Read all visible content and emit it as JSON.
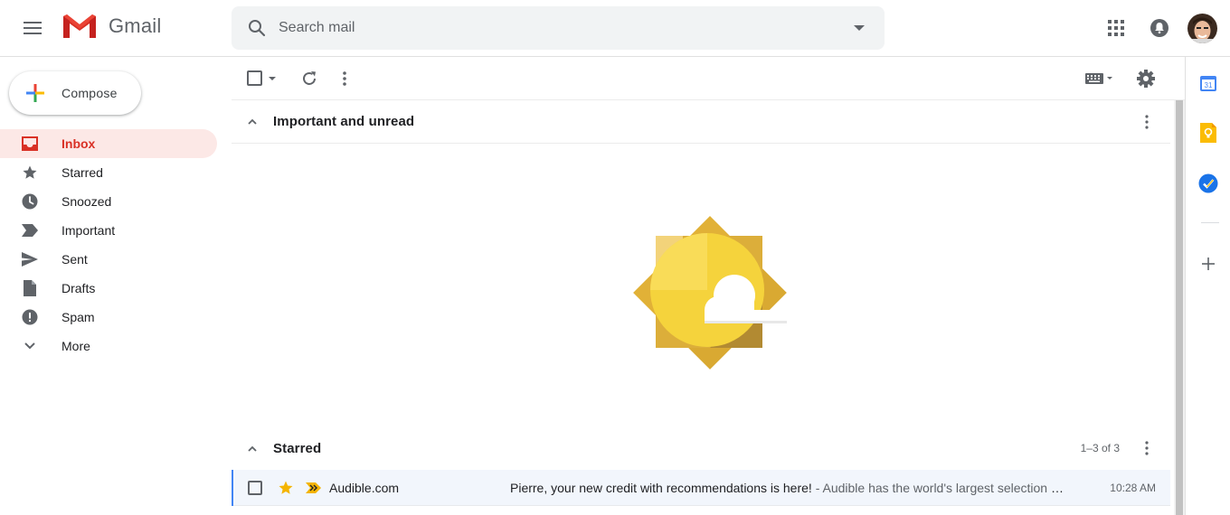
{
  "app": {
    "name": "Gmail"
  },
  "search": {
    "placeholder": "Search mail"
  },
  "compose": {
    "label": "Compose"
  },
  "sidebar": {
    "items": [
      {
        "label": "Inbox",
        "icon": "inbox-icon",
        "active": true
      },
      {
        "label": "Starred",
        "icon": "star-icon"
      },
      {
        "label": "Snoozed",
        "icon": "clock-icon"
      },
      {
        "label": "Important",
        "icon": "important-icon"
      },
      {
        "label": "Sent",
        "icon": "send-icon"
      },
      {
        "label": "Drafts",
        "icon": "draft-icon"
      },
      {
        "label": "Spam",
        "icon": "spam-icon"
      },
      {
        "label": "More",
        "icon": "chevron-down-icon"
      }
    ]
  },
  "sections": {
    "important": {
      "title": "Important and unread"
    },
    "starred": {
      "title": "Starred",
      "count": "1–3 of 3"
    }
  },
  "emails": [
    {
      "sender": "Audible.com",
      "subject": "Pierre, your new credit with recommendations is here!",
      "snippet": " - Audible has the world's largest selection of audiobooks",
      "time": "10:28 AM",
      "starred": true,
      "important": true
    }
  ],
  "colors": {
    "accent_red": "#d93025",
    "active_bg": "#fce8e6",
    "star": "#f4b400",
    "important": "#f4b400",
    "selected_row_border": "#4285f4"
  },
  "right_rail": [
    "calendar-icon",
    "keep-icon",
    "tasks-icon",
    "add-addon-icon"
  ]
}
